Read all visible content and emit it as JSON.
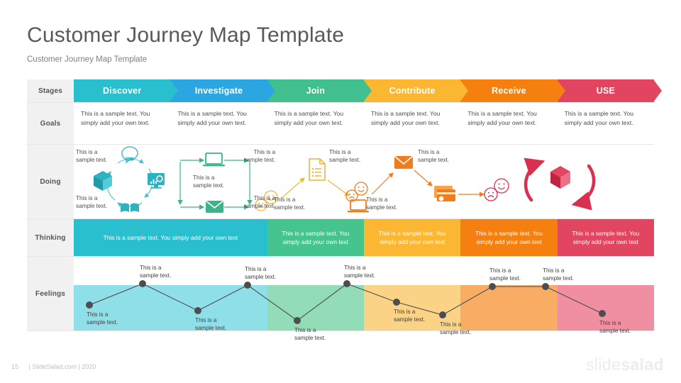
{
  "header": {
    "title": "Customer Journey Map Template",
    "subtitle": "Customer Journey Map Template"
  },
  "row_labels": {
    "stages": "Stages",
    "goals": "Goals",
    "doing": "Doing",
    "thinking": "Thinking",
    "feelings": "Feelings"
  },
  "stages": [
    {
      "label": "Discover",
      "color": "#29bfce"
    },
    {
      "label": "Investigate",
      "color": "#2ba6e0"
    },
    {
      "label": "Join",
      "color": "#42bf8f"
    },
    {
      "label": "Contribute",
      "color": "#fbb731"
    },
    {
      "label": "Receive",
      "color": "#f5800f"
    },
    {
      "label": "USE",
      "color": "#e2455f"
    }
  ],
  "goals": [
    "This is a sample text. You simply add your own text.",
    "This is a sample text. You simply add your own text.",
    "This is a sample text. You simply add your own text.",
    "This is a sample text. You simply add your own text.",
    "This is a sample text. You simply add your own text.",
    "This is a sample text. You simply add your own text."
  ],
  "doing": {
    "labels": [
      "This is a\nsample text.",
      "This is a\nsample text.",
      "This is a\nsample text.",
      "This is a\nsample text.",
      "This is a\nsample text.",
      "This is a\nsample text.",
      "This is a\nsample text.",
      "This is a\nsample text.",
      "This is a\nsample text.",
      "This is a\nsample text."
    ],
    "icons": [
      "chat-bubble-icon",
      "monitor-chart-icon",
      "book-icon",
      "box-icon",
      "laptop-icon",
      "envelope-icon",
      "sad-face-icon",
      "happy-face-icon",
      "document-list-icon",
      "sad-face-icon",
      "happy-face-icon",
      "laptop-icon",
      "envelope-icon",
      "credit-card-icon",
      "sad-face-icon",
      "happy-face-icon",
      "box-icon"
    ],
    "colors": {
      "discover": "#2bb3c0",
      "investigate": "#3bb38b",
      "join": "#f0b43a",
      "contribute": "#f07c1e",
      "receive": "#d9304f"
    }
  },
  "thinking": {
    "blocks": [
      {
        "text": "This is a sample text. You simply add your own text",
        "color": "#29bfce",
        "span": 2
      },
      {
        "text": "This is a sample text. You simply add your own text",
        "color": "#45c48d",
        "span": 1
      },
      {
        "text": "This is a sample text. You simply add your own text",
        "color": "#fbb731",
        "span": 1
      },
      {
        "text": "This is a sample text. You simply add your own text",
        "color": "#f5800f",
        "span": 1
      },
      {
        "text": "This is a sample text. You simply add your own text",
        "color": "#e2455f",
        "span": 1
      }
    ]
  },
  "feelings": {
    "bands": [
      {
        "color": "#8fdfe8",
        "span": 2
      },
      {
        "color": "#93dcb8",
        "span": 1
      },
      {
        "color": "#fbd386",
        "span": 1
      },
      {
        "color": "#f9ac63",
        "span": 1
      },
      {
        "color": "#ef8fa1",
        "span": 1
      }
    ],
    "labels": [
      "This is a sample text.",
      "This is a sample text.",
      "This is a sample text.",
      "This is a sample text.",
      "This is a sample text.",
      "This is a sample text.",
      "This is a sample text.",
      "This is a sample text.",
      "This is a sample text.",
      "This is a sample text.",
      "This is a sample text."
    ]
  },
  "chart_data": {
    "type": "line",
    "title": "Feelings",
    "xlabel": "",
    "ylabel": "",
    "x": [
      1,
      2,
      3,
      4,
      5,
      6,
      7,
      8,
      9,
      10,
      11
    ],
    "values": [
      36,
      66,
      28,
      64,
      14,
      66,
      40,
      22,
      62,
      62,
      24
    ],
    "ylim": [
      0,
      104
    ],
    "point_color": "#4d4d4d",
    "line_color": "#4d4d4d",
    "grid": false,
    "legend": "none",
    "point_labels": [
      "This is a sample text.",
      "This is a sample text.",
      "This is a sample text.",
      "This is a sample text.",
      "This is a sample text.",
      "This is a sample text.",
      "This is a sample text.",
      "This is a sample text.",
      "This is a sample text.",
      "This is a sample text.",
      "This is a sample text."
    ]
  },
  "footer": {
    "page": "15",
    "credit": "| SlideSalad.com | 2020",
    "logo_light": "slide",
    "logo_bold": "salad"
  }
}
